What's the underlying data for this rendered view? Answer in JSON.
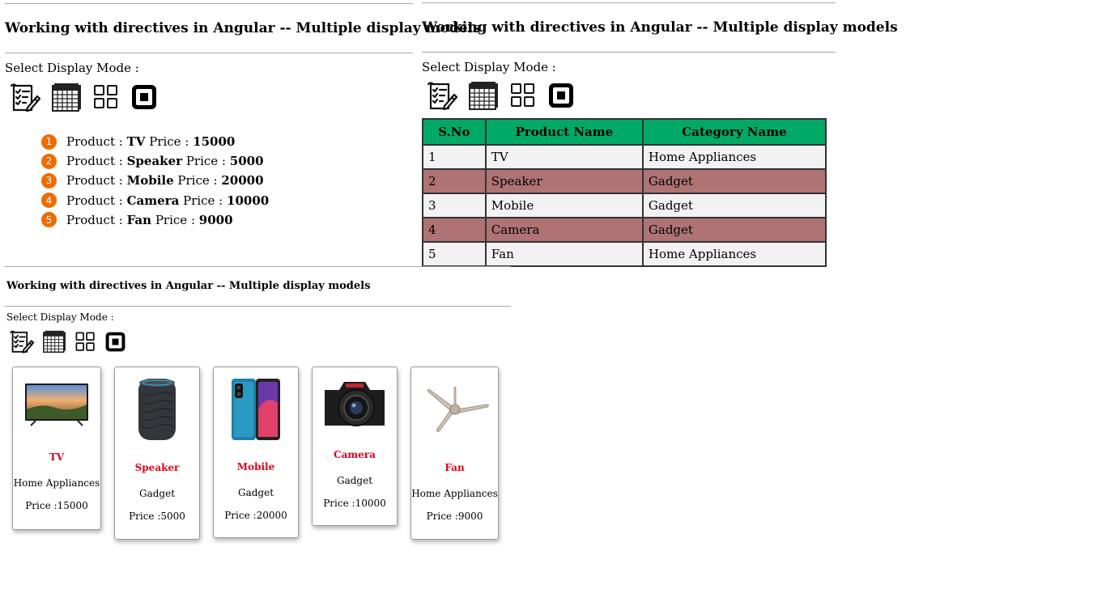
{
  "heading": "Working with directives in Angular -- Multiple display models",
  "select_mode_label": "Select Display Mode :",
  "modes": [
    {
      "name": "list-mode",
      "icon": "checklist-pencil-icon"
    },
    {
      "name": "table-mode",
      "icon": "spreadsheet-icon"
    },
    {
      "name": "grid-mode",
      "icon": "grid-icon"
    },
    {
      "name": "single-mode",
      "icon": "square-icon"
    }
  ],
  "list_text": {
    "product_prefix": "Product :",
    "price_prefix": "Price :"
  },
  "table": {
    "headers": [
      "S.No",
      "Product Name",
      "Category Name"
    ],
    "header_color": "#00aa66",
    "odd_row_color": "#f2f2f2",
    "even_row_color": "#af7373"
  },
  "card_text": {
    "price_prefix": "Price :"
  },
  "products": [
    {
      "sno": "1",
      "name": "TV",
      "category": "Home Appliances",
      "price": "15000"
    },
    {
      "sno": "2",
      "name": "Speaker",
      "category": "Gadget",
      "price": "5000"
    },
    {
      "sno": "3",
      "name": "Mobile",
      "category": "Gadget",
      "price": "20000"
    },
    {
      "sno": "4",
      "name": "Camera",
      "category": "Gadget",
      "price": "10000"
    },
    {
      "sno": "5",
      "name": "Fan",
      "category": "Home Appliances",
      "price": "9000"
    }
  ],
  "colors": {
    "badge": "#f06b00",
    "card_name": "#e0001a"
  }
}
